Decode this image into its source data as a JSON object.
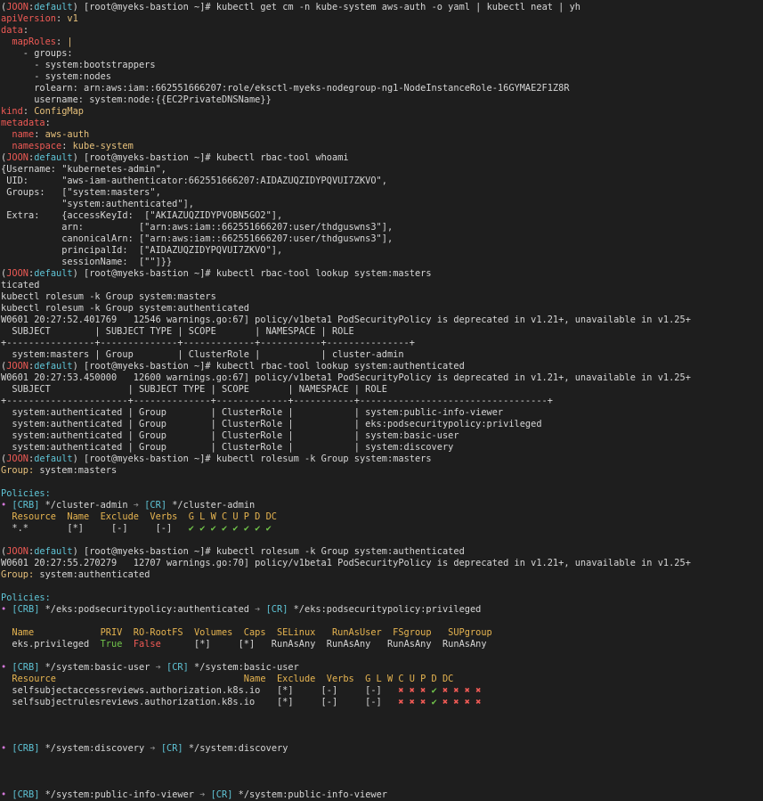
{
  "terminal": {
    "prompt": {
      "open": "(",
      "ctx": "JOON",
      "sep": ":",
      "ns": "default",
      "close": ")",
      "host": " [root@myeks-bastion ~]# "
    },
    "colors": {
      "bg": "#1e1e1e",
      "fg": "#d6d6d6",
      "red": "#ef5a55",
      "cyan": "#5fc4d6",
      "yellow": "#e6c07b",
      "green": "#71c44a",
      "magenta": "#d277d8"
    },
    "lines": [
      {
        "t": "prompt",
        "cmd": "kubectl get cm -n kube-system aws-auth -o yaml | kubectl neat | yh"
      },
      {
        "t": "kv",
        "key": "apiVersion",
        "val": " v1",
        "ind": ""
      },
      {
        "t": "key",
        "key": "data",
        "ind": ""
      },
      {
        "t": "kv",
        "key": "mapRoles",
        "val": " |",
        "ind": "  "
      },
      {
        "t": "plain",
        "text": "    - groups:"
      },
      {
        "t": "plain",
        "text": "      - system:bootstrappers"
      },
      {
        "t": "plain",
        "text": "      - system:nodes"
      },
      {
        "t": "plain",
        "text": "      rolearn: arn:aws:iam::662551666207:role/eksctl-myeks-nodegroup-ng1-NodeInstanceRole-16GYMAE2F1Z8R"
      },
      {
        "t": "plain",
        "text": "      username: system:node:{{EC2PrivateDNSName}}"
      },
      {
        "t": "kv",
        "key": "kind",
        "val": " ConfigMap",
        "ind": ""
      },
      {
        "t": "key",
        "key": "metadata",
        "ind": ""
      },
      {
        "t": "kv",
        "key": "name",
        "val": " aws-auth",
        "ind": "  "
      },
      {
        "t": "kv",
        "key": "namespace",
        "val": " kube-system",
        "ind": "  "
      },
      {
        "t": "prompt",
        "cmd": "kubectl rbac-tool whoami"
      },
      {
        "t": "plain",
        "text": "{Username: \"kubernetes-admin\","
      },
      {
        "t": "plain",
        "text": " UID:      \"aws-iam-authenticator:662551666207:AIDAZUQZIDYPQVUI7ZKVO\","
      },
      {
        "t": "plain",
        "text": " Groups:   [\"system:masters\","
      },
      {
        "t": "plain",
        "text": "           \"system:authenticated\"],"
      },
      {
        "t": "plain",
        "text": " Extra:    {accessKeyId:  [\"AKIAZUQZIDYPVOBN5GO2\"],"
      },
      {
        "t": "plain",
        "text": "           arn:          [\"arn:aws:iam::662551666207:user/thdguswns3\"],"
      },
      {
        "t": "plain",
        "text": "           canonicalArn: [\"arn:aws:iam::662551666207:user/thdguswns3\"],"
      },
      {
        "t": "plain",
        "text": "           principalId:  [\"AIDAZUQZIDYPQVUI7ZKVO\"],"
      },
      {
        "t": "plain",
        "text": "           sessionName:  [\"\"]}}"
      },
      {
        "t": "prompt",
        "cmd": "kubectl rbac-tool lookup system:masters"
      },
      {
        "t": "plain",
        "text": "ticated"
      },
      {
        "t": "plain",
        "text": "kubectl rolesum -k Group system:masters"
      },
      {
        "t": "plain",
        "text": "kubectl rolesum -k Group system:authenticated"
      },
      {
        "t": "plain",
        "text": "W0601 20:27:52.401769   12546 warnings.go:67] policy/v1beta1 PodSecurityPolicy is deprecated in v1.21+, unavailable in v1.25+"
      },
      {
        "t": "plain",
        "text": "  SUBJECT        | SUBJECT TYPE | SCOPE       | NAMESPACE | ROLE"
      },
      {
        "t": "plain",
        "text": "+----------------+--------------+-------------+-----------+---------------+"
      },
      {
        "t": "plain",
        "text": "  system:masters | Group        | ClusterRole |           | cluster-admin"
      },
      {
        "t": "prompt",
        "cmd": "kubectl rbac-tool lookup system:authenticated"
      },
      {
        "t": "plain",
        "text": "W0601 20:27:53.450000   12600 warnings.go:67] policy/v1beta1 PodSecurityPolicy is deprecated in v1.21+, unavailable in v1.25+"
      },
      {
        "t": "plain",
        "text": "  SUBJECT              | SUBJECT TYPE | SCOPE       | NAMESPACE | ROLE"
      },
      {
        "t": "plain",
        "text": "+----------------------+--------------+-------------+-----------+----------------------------------+"
      },
      {
        "t": "plain",
        "text": "  system:authenticated | Group        | ClusterRole |           | system:public-info-viewer"
      },
      {
        "t": "plain",
        "text": "  system:authenticated | Group        | ClusterRole |           | eks:podsecuritypolicy:privileged"
      },
      {
        "t": "plain",
        "text": "  system:authenticated | Group        | ClusterRole |           | system:basic-user"
      },
      {
        "t": "plain",
        "text": "  system:authenticated | Group        | ClusterRole |           | system:discovery"
      },
      {
        "t": "prompt",
        "cmd": "kubectl rolesum -k Group system:masters"
      },
      {
        "t": "kv2",
        "key": "Group",
        "val": " system:masters"
      },
      {
        "t": "blank"
      },
      {
        "t": "head",
        "text": "Policies:"
      },
      {
        "t": "policy",
        "crb": "*/cluster-admin",
        "cr": "*/cluster-admin"
      },
      {
        "t": "hdr",
        "text": "  Resource  Name  Exclude  Verbs  G L W C U P D DC"
      },
      {
        "t": "verbs",
        "prefix": "  *.*       [*]     [-]     [-]   ",
        "marks": "vvvvvvvv"
      },
      {
        "t": "blank"
      },
      {
        "t": "prompt",
        "cmd": "kubectl rolesum -k Group system:authenticated"
      },
      {
        "t": "plain",
        "text": "W0601 20:27:55.270279   12707 warnings.go:70] policy/v1beta1 PodSecurityPolicy is deprecated in v1.21+, unavailable in v1.25+"
      },
      {
        "t": "kv2",
        "key": "Group",
        "val": " system:authenticated"
      },
      {
        "t": "blank"
      },
      {
        "t": "head",
        "text": "Policies:"
      },
      {
        "t": "policy",
        "crb": "*/eks:podsecuritypolicy:authenticated",
        "cr": "*/eks:podsecuritypolicy:privileged"
      },
      {
        "t": "blank"
      },
      {
        "t": "hdr",
        "text": "  Name            PRIV  RO-RootFS  Volumes  Caps  SELinux   RunAsUser  FSgroup   SUPgroup"
      },
      {
        "t": "psp",
        "name": "  eks.privileged  ",
        "priv": "True",
        "ro": "False",
        "rest": "      [*]     [*]   RunAsAny  RunAsAny   RunAsAny  RunAsAny"
      },
      {
        "t": "blank"
      },
      {
        "t": "policy",
        "crb": "*/system:basic-user",
        "cr": "*/system:basic-user"
      },
      {
        "t": "hdr",
        "text": "  Resource                                  Name  Exclude  Verbs  G L W C U P D DC"
      },
      {
        "t": "verbs",
        "prefix": "  selfsubjectaccessreviews.authorization.k8s.io   [*]     [-]     [-]   ",
        "marks": "xxxvxxxx"
      },
      {
        "t": "verbs",
        "prefix": "  selfsubjectrulesreviews.authorization.k8s.io    [*]     [-]     [-]   ",
        "marks": "xxxvxxxx"
      },
      {
        "t": "blank"
      },
      {
        "t": "blank"
      },
      {
        "t": "blank"
      },
      {
        "t": "policy",
        "crb": "*/system:discovery",
        "cr": "*/system:discovery"
      },
      {
        "t": "blank"
      },
      {
        "t": "blank"
      },
      {
        "t": "blank"
      },
      {
        "t": "policy",
        "crb": "*/system:public-info-viewer",
        "cr": "*/system:public-info-viewer"
      }
    ]
  }
}
